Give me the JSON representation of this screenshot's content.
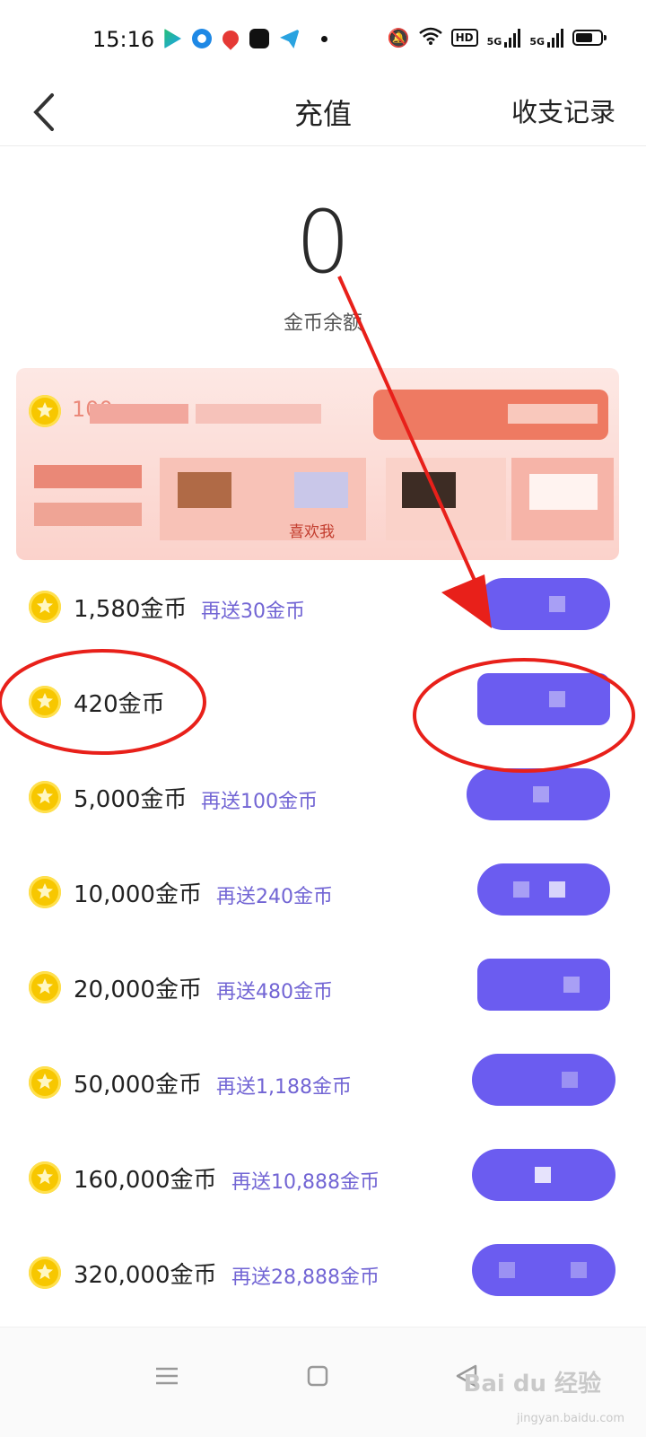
{
  "status_bar": {
    "time": "15:16",
    "network": [
      "HD",
      "5G",
      "5G"
    ]
  },
  "header": {
    "title": "充值",
    "right_link": "收支记录"
  },
  "balance": {
    "value": "0",
    "label": "金币余额"
  },
  "promo_banner": {
    "visible_text": "喜欢我",
    "partial_number": "100"
  },
  "packages": [
    {
      "amount": "1,580金币",
      "bonus": "再送30金币"
    },
    {
      "amount": "420金币",
      "bonus": ""
    },
    {
      "amount": "5,000金币",
      "bonus": "再送100金币"
    },
    {
      "amount": "10,000金币",
      "bonus": "再送240金币"
    },
    {
      "amount": "20,000金币",
      "bonus": "再送480金币"
    },
    {
      "amount": "50,000金币",
      "bonus": "再送1,188金币"
    },
    {
      "amount": "160,000金币",
      "bonus": "再送10,888金币"
    },
    {
      "amount": "320,000金币",
      "bonus": "再送28,888金币"
    }
  ],
  "watermark": {
    "main": "Bai du 经验",
    "sub": "jingyan.baidu.com"
  },
  "colors": {
    "accent": "#6b5cf0",
    "bonus_text": "#7265d4",
    "coin": "#f7c700",
    "annotation": "#e8201a"
  }
}
